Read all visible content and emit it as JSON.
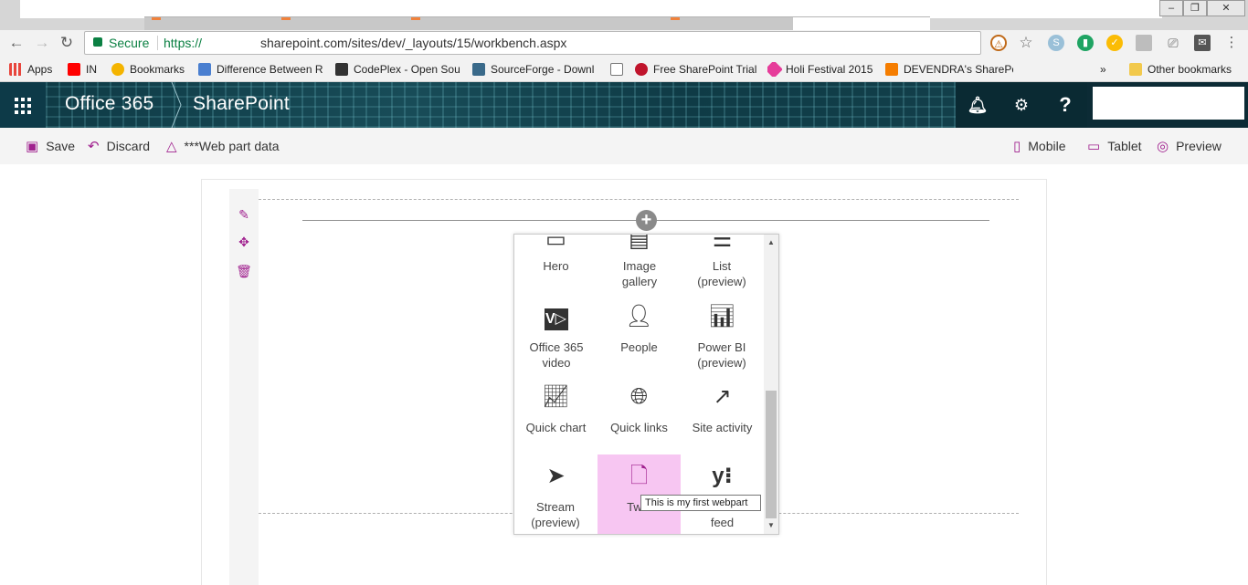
{
  "browser": {
    "url": {
      "secure_label": "Secure",
      "protocol": "https://",
      "host_path": "sharepoint.com/sites/dev/_layouts/15/workbench.aspx"
    },
    "bookmarks": [
      {
        "label": "Apps",
        "icon": "apps-grid-icon",
        "color": "#e8453c"
      },
      {
        "label": "IN",
        "icon": "youtube-icon",
        "color": "#ff0000"
      },
      {
        "label": "Bookmarks",
        "icon": "star-icon",
        "color": "#f4b400"
      },
      {
        "label": "Difference Between R",
        "icon": "d-icon",
        "color": "#4a7fd0"
      },
      {
        "label": "CodePlex - Open Sou",
        "icon": "codeplex-icon",
        "color": "#333333"
      },
      {
        "label": "SourceForge - Downl",
        "icon": "sourceforge-icon",
        "color": "#3a6a8a"
      },
      {
        "label": "",
        "icon": "page-icon",
        "color": "#777777"
      },
      {
        "label": "Free SharePoint Trial",
        "icon": "rocket-icon",
        "color": "#c0142c"
      },
      {
        "label": "Holi Festival 2015",
        "icon": "holi-icon",
        "color": "#e63d9a"
      },
      {
        "label": "DEVENDRA's SharePo",
        "icon": "blogger-icon",
        "color": "#f57d00"
      },
      {
        "label": "Other bookmarks",
        "icon": "folder-icon",
        "color": "#f2c94c"
      }
    ],
    "overflow_label": "»"
  },
  "suitebar": {
    "app_name": "Office 365",
    "site_name": "SharePoint",
    "notifications_icon": "bell-icon",
    "settings_icon": "gear-icon",
    "help_label": "?"
  },
  "commandbar": {
    "save": "Save",
    "discard": "Discard",
    "webpart_data": "***Web part data",
    "mobile": "Mobile",
    "tablet": "Tablet",
    "preview": "Preview"
  },
  "toolbox": {
    "tiles": [
      {
        "label": "Hero",
        "icon": "hero-icon"
      },
      {
        "label": "Image gallery",
        "icon": "image-gallery-icon"
      },
      {
        "label": "List (preview)",
        "icon": "list-icon"
      },
      {
        "label": "Office 365 video",
        "icon": "video-icon"
      },
      {
        "label": "People",
        "icon": "people-icon"
      },
      {
        "label": "Power BI (preview)",
        "icon": "powerbi-icon"
      },
      {
        "label": "Quick chart",
        "icon": "chart-icon"
      },
      {
        "label": "Quick links",
        "icon": "globe-icon"
      },
      {
        "label": "Site activity",
        "icon": "trend-icon"
      },
      {
        "label": "Stream (preview)",
        "icon": "stream-icon"
      },
      {
        "label": "Twin",
        "icon": "document-icon"
      },
      {
        "label": "feed",
        "icon": "yammer-icon"
      }
    ],
    "tooltip": "This is my first webpart"
  },
  "colors": {
    "accent": "#a0208e",
    "highlight": "#f7c6f2",
    "suitebar": "#0c2b35"
  }
}
